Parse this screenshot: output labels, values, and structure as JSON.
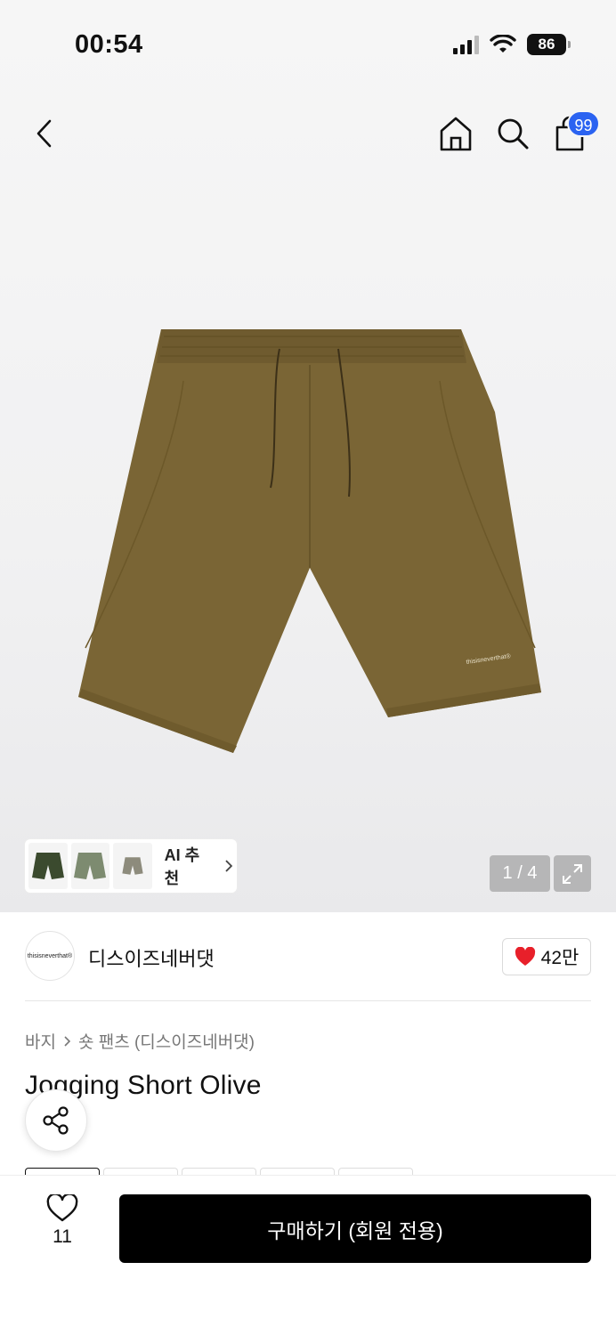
{
  "status_bar": {
    "time": "00:54",
    "battery": "86"
  },
  "header": {
    "cart_count": "99"
  },
  "gallery": {
    "counter": "1 / 4",
    "ai_recommend_label": "AI 추천",
    "thumb_colors": [
      "#3b4a2e",
      "#7d8b70",
      "#8d8b7c"
    ],
    "product_color": "#7a6535",
    "print_text": "thisisneverthat®"
  },
  "brand": {
    "logo_text": "thisisneverthat®",
    "name": "디스이즈네버댓",
    "likes": "42만"
  },
  "breadcrumb": {
    "category": "바지",
    "subcategory": "숏 팬츠 (디스이즈네버댓)"
  },
  "product": {
    "title": "Jogging Short Olive"
  },
  "bottom_bar": {
    "wish_count": "11",
    "buy_label": "구매하기 (회원 전용)"
  },
  "colors": {
    "accent_badge": "#2b63f1",
    "heart": "#e8202a",
    "buy_bg": "#000000"
  }
}
